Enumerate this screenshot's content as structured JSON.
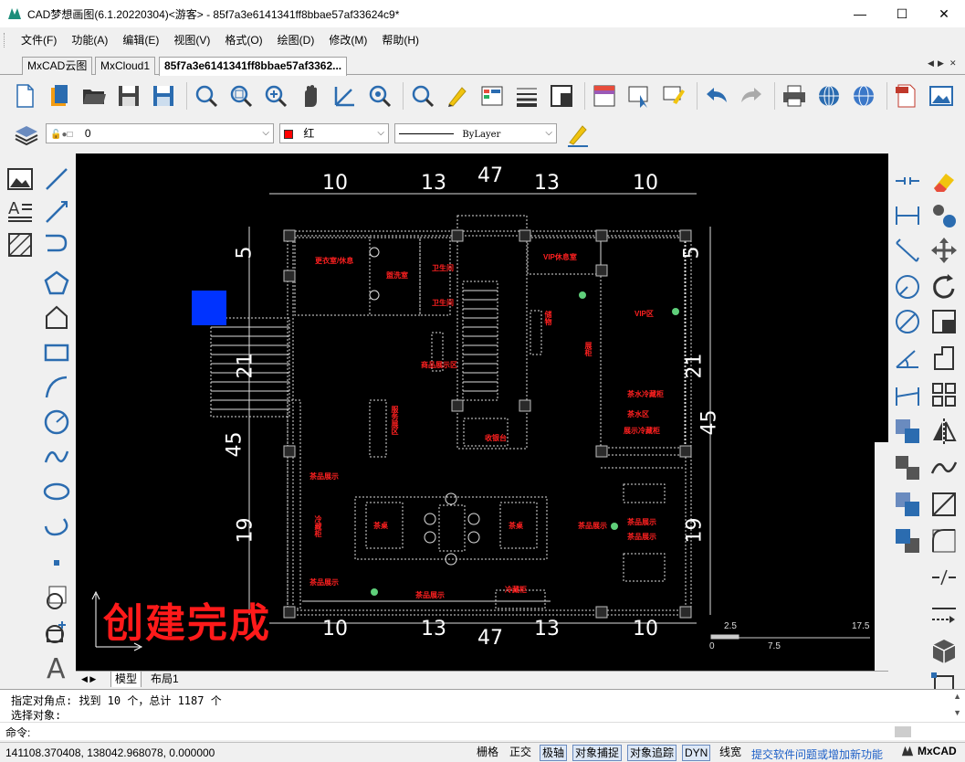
{
  "window": {
    "title": "CAD梦想画图(6.1.20220304)<游客> - 85f7a3e6141341ff8bbae57af33624c9*",
    "controls": [
      "—",
      "☐",
      "✕"
    ]
  },
  "menu": [
    "文件(F)",
    "功能(A)",
    "编辑(E)",
    "视图(V)",
    "格式(O)",
    "绘图(D)",
    "修改(M)",
    "帮助(H)"
  ],
  "tabs": [
    {
      "label": "MxCAD云图",
      "active": false
    },
    {
      "label": "MxCloud1",
      "active": false
    },
    {
      "label": "85f7a3e6141341ff8bbae57af3362...",
      "active": true
    }
  ],
  "tab_nav": [
    "◀",
    "▶",
    "✕"
  ],
  "properties": {
    "layer_value": "0",
    "color_value": "红",
    "color_swatch": "#ff0000",
    "linetype_value": "ByLayer"
  },
  "drawing": {
    "dim_top": [
      "10",
      "13",
      "47",
      "13",
      "10"
    ],
    "dim_bottom": [
      "10",
      "13",
      "47",
      "13",
      "10"
    ],
    "dim_left": [
      "5",
      "21",
      "45",
      "19"
    ],
    "dim_right": [
      "5",
      "21",
      "45",
      "19"
    ],
    "room_labels": [
      "更衣室/休息",
      "盥洗室",
      "卫生间",
      "卫生间",
      "VIP休息室",
      "储物",
      "展柜",
      "服务展区",
      "VIP区",
      "商品展示区",
      "收银台",
      "茶水区",
      "茶水冷藏柜",
      "展示冷藏柜",
      "茶品展示",
      "冷藏柜",
      "茶品展示",
      "茶品展示",
      "茶品展示",
      "茶品展示",
      "茶品展示",
      "茶桌",
      "茶桌",
      "冷藏柜"
    ],
    "completion_text": "创建完成",
    "scale_labels": [
      "2.5",
      "17.5",
      "0",
      "7.5"
    ],
    "highlight_color": "#0033ff"
  },
  "layout_tabs": [
    "模型",
    "布局1"
  ],
  "command": {
    "line1": "指定对角点:  找到 10 个，总计 1187 个",
    "line2": "选择对象:",
    "prompt": "命令:"
  },
  "status": {
    "coords": "141108.370408,  138042.968078,  0.000000",
    "buttons": [
      {
        "label": "栅格",
        "on": false
      },
      {
        "label": "正交",
        "on": false
      },
      {
        "label": "极轴",
        "on": true
      },
      {
        "label": "对象捕捉",
        "on": true
      },
      {
        "label": "对象追踪",
        "on": true
      },
      {
        "label": "DYN",
        "on": true
      },
      {
        "label": "线宽",
        "on": false
      }
    ],
    "feedback_link": "提交软件问题或增加新功能",
    "brand": "MxCAD"
  }
}
